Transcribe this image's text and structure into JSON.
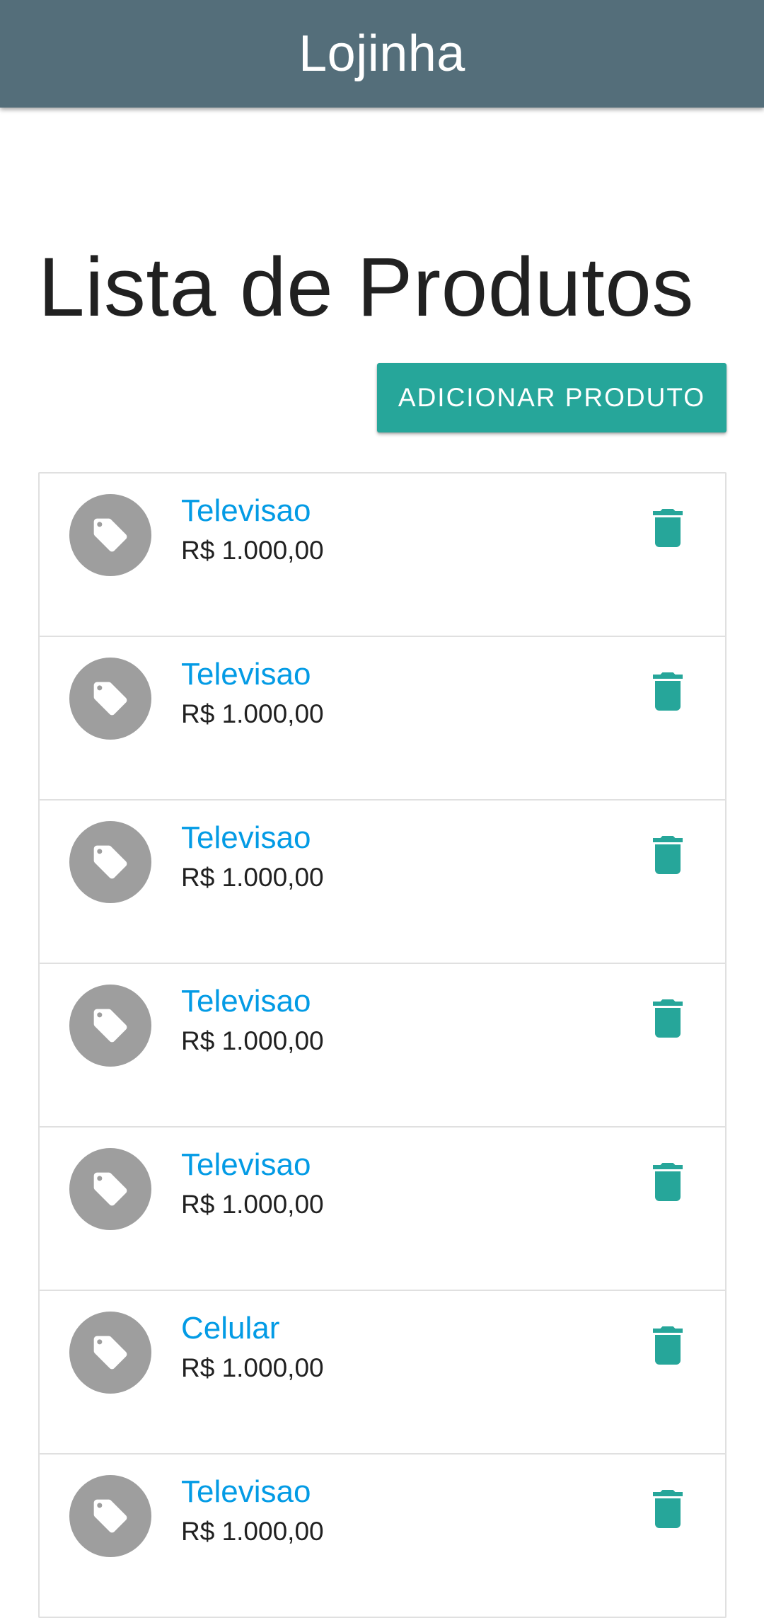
{
  "app_bar": {
    "title": "Lojinha"
  },
  "page": {
    "title": "Lista de Produtos"
  },
  "actions": {
    "add_product_label": "ADICIONAR PRODUTO"
  },
  "products": [
    {
      "name": "Televisao",
      "price": "R$ 1.000,00",
      "icon": "tag-icon"
    },
    {
      "name": "Televisao",
      "price": "R$ 1.000,00",
      "icon": "tag-icon"
    },
    {
      "name": "Televisao",
      "price": "R$ 1.000,00",
      "icon": "tag-icon"
    },
    {
      "name": "Televisao",
      "price": "R$ 1.000,00",
      "icon": "tag-icon"
    },
    {
      "name": "Televisao",
      "price": "R$ 1.000,00",
      "icon": "tag-icon"
    },
    {
      "name": "Celular",
      "price": "R$ 1.000,00",
      "icon": "tag-icon"
    },
    {
      "name": "Televisao",
      "price": "R$ 1.000,00",
      "icon": "tag-icon"
    }
  ],
  "colors": {
    "app_bar": "#546e7a",
    "accent": "#26a69a",
    "link": "#039be5",
    "avatar": "#9e9e9e"
  }
}
